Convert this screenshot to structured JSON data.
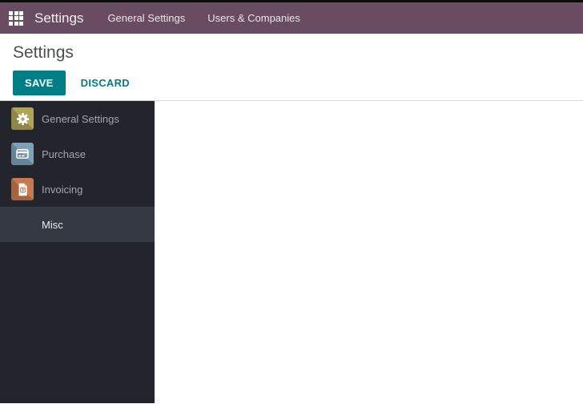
{
  "navbar": {
    "title": "Settings",
    "menu": [
      {
        "label": "General Settings"
      },
      {
        "label": "Users & Companies"
      }
    ]
  },
  "control_panel": {
    "title": "Settings",
    "save_label": "SAVE",
    "discard_label": "DISCARD"
  },
  "sidebar": {
    "items": [
      {
        "label": "General Settings",
        "icon": "gear-app-icon",
        "color": "#b1a459"
      },
      {
        "label": "Purchase",
        "icon": "credit-card-app-icon",
        "color": "#7ea1b7"
      },
      {
        "label": "Invoicing",
        "icon": "invoice-app-icon",
        "color": "#c77a4f",
        "icon_glyph": "$"
      },
      {
        "label": "Misc",
        "selected": true
      }
    ]
  },
  "colors": {
    "navbar_bg": "#6a4c62",
    "accent_teal": "#017e84",
    "sidebar_bg": "#22252b",
    "sidebar_selected_bg": "#353943",
    "top_strip": "#0b0b0d"
  }
}
